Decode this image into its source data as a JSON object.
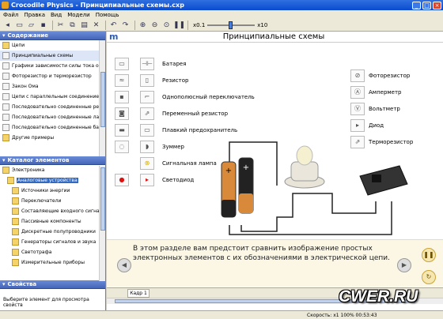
{
  "window": {
    "title": "Crocodile Physics - Принципиальные схемы.cxp"
  },
  "menu": [
    "Файл",
    "Правка",
    "Вид",
    "Модели",
    "Помощь"
  ],
  "toolbar": {
    "zoom_min": "x0.1",
    "zoom_max": "x10"
  },
  "contents_panel": {
    "title": "Содержание",
    "items": [
      {
        "label": "Цепи",
        "kind": "folder"
      },
      {
        "label": "Принципиальные схемы",
        "kind": "page",
        "selected": true
      },
      {
        "label": "Графики зависимости силы тока о",
        "kind": "page"
      },
      {
        "label": "Фоторезистор и терморезистор",
        "kind": "page"
      },
      {
        "label": "Закон Ома",
        "kind": "page"
      },
      {
        "label": "Цепи с параллельным соединение",
        "kind": "page"
      },
      {
        "label": "Последовательно соединенные ре",
        "kind": "page"
      },
      {
        "label": "Последовательно соединенные ла",
        "kind": "page"
      },
      {
        "label": "Последовательно соединенные ба",
        "kind": "page"
      },
      {
        "label": "Другие примеры",
        "kind": "folder"
      }
    ]
  },
  "catalog_panel": {
    "title": "Каталог элементов",
    "items": [
      {
        "label": "Электроника",
        "kind": "folder",
        "indent": 0
      },
      {
        "label": "Аналоговые устройства",
        "kind": "folder",
        "indent": 1,
        "highlighted": true
      },
      {
        "label": "Источники энергии",
        "kind": "folder",
        "indent": 2
      },
      {
        "label": "Переключатели",
        "kind": "folder",
        "indent": 2
      },
      {
        "label": "Составляющие входного сигна",
        "kind": "folder",
        "indent": 2
      },
      {
        "label": "Пассивные компоненты",
        "kind": "folder",
        "indent": 2
      },
      {
        "label": "Дискретные полупроводники",
        "kind": "folder",
        "indent": 2
      },
      {
        "label": "Генераторы сигналов и звука",
        "kind": "folder",
        "indent": 2
      },
      {
        "label": "Светотрафа",
        "kind": "folder",
        "indent": 2
      },
      {
        "label": "Измерительные приборы",
        "kind": "folder",
        "indent": 2
      }
    ]
  },
  "properties_panel": {
    "title": "Свойства",
    "hint": "Выберите элемент для просмотра свойств"
  },
  "page": {
    "title": "Принципиальные схемы",
    "left_symbols": [
      "Батарея",
      "Резистор",
      "Однополюсный переключатель",
      "Переменный резистор",
      "Плавкий предохранитель",
      "Зуммер",
      "Сигнальная лампа",
      "Светодиод"
    ],
    "right_symbols": [
      "Фоторезистор",
      "Амперметр",
      "Вольтметр",
      "Диод",
      "Терморезистор"
    ],
    "description": "В этом разделе вам предстоит сравнить изображение простых электронных элементов с их обозначениями в электрической цепи."
  },
  "frame_tab": "Кадр 1",
  "status": "Скорость: x1  100%   00:53:43",
  "watermark": "CWER.RU"
}
